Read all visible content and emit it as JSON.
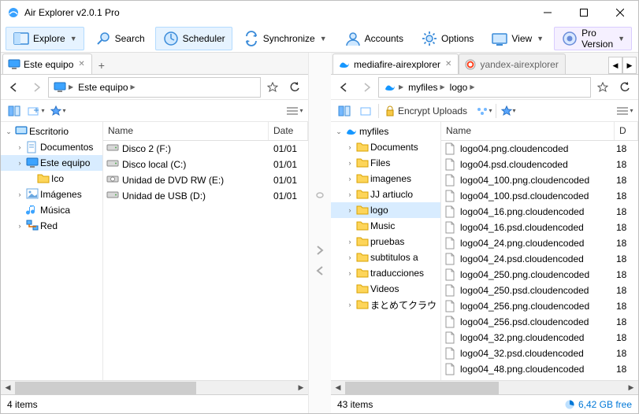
{
  "window": {
    "title": "Air Explorer v2.0.1 Pro"
  },
  "toolbar": [
    {
      "id": "explore",
      "label": "Explore",
      "sel": true,
      "icon": "explore",
      "caret": true
    },
    {
      "id": "search",
      "label": "Search",
      "icon": "search"
    },
    {
      "id": "scheduler",
      "label": "Scheduler",
      "sel": true,
      "icon": "scheduler"
    },
    {
      "id": "sync",
      "label": "Synchronize",
      "icon": "sync",
      "caret": true
    },
    {
      "id": "accounts",
      "label": "Accounts",
      "icon": "accounts"
    },
    {
      "id": "options",
      "label": "Options",
      "icon": "options"
    },
    {
      "id": "view",
      "label": "View",
      "icon": "view",
      "caret": true
    },
    {
      "id": "pro",
      "label": "Pro Version",
      "icon": "pro",
      "caret": true,
      "pro": true
    },
    {
      "id": "help",
      "label": "",
      "icon": "help",
      "caret": true
    }
  ],
  "left": {
    "tabs": [
      {
        "label": "Este equipo",
        "icon": "monitor",
        "active": true
      }
    ],
    "path": [
      {
        "icon": "monitor"
      },
      {
        "label": "Este equipo"
      }
    ],
    "tree": [
      {
        "depth": 0,
        "exp": "v",
        "icon": "desktop",
        "label": "Escritorio"
      },
      {
        "depth": 1,
        "exp": ">",
        "icon": "docs",
        "label": "Documentos",
        "hov": false
      },
      {
        "depth": 1,
        "exp": ">",
        "icon": "monitor",
        "label": "Este equipo",
        "sel": true
      },
      {
        "depth": 2,
        "exp": "",
        "icon": "folder",
        "label": "Ico"
      },
      {
        "depth": 1,
        "exp": ">",
        "icon": "pics",
        "label": "Imágenes"
      },
      {
        "depth": 1,
        "exp": "",
        "icon": "music",
        "label": "Música"
      },
      {
        "depth": 1,
        "exp": ">",
        "icon": "net",
        "label": "Red"
      }
    ],
    "columns": {
      "name": "Name",
      "date": "Date"
    },
    "items": [
      {
        "name": "Disco 2 (F:)",
        "date": "01/01",
        "icon": "drive"
      },
      {
        "name": "Disco local (C:)",
        "date": "01/01",
        "icon": "drive"
      },
      {
        "name": "Unidad de DVD RW (E:)",
        "date": "01/01",
        "icon": "dvd"
      },
      {
        "name": "Unidad de USB (D:)",
        "date": "01/01",
        "icon": "drive"
      }
    ],
    "status": "4 items"
  },
  "right": {
    "tabs": [
      {
        "label": "mediafire-airexplorer",
        "icon": "mediafire",
        "active": true
      },
      {
        "label": "yandex-airexplorer",
        "icon": "yandex",
        "active": false
      }
    ],
    "path": [
      {
        "icon": "mediafire"
      },
      {
        "label": "myfiles"
      },
      {
        "label": "logo"
      }
    ],
    "encrypt_label": "Encrypt Uploads",
    "tree": [
      {
        "depth": 0,
        "exp": "v",
        "icon": "mediafire",
        "label": "myfiles"
      },
      {
        "depth": 1,
        "exp": ">",
        "icon": "folder",
        "label": "Documents"
      },
      {
        "depth": 1,
        "exp": ">",
        "icon": "folder",
        "label": "Files"
      },
      {
        "depth": 1,
        "exp": ">",
        "icon": "folder",
        "label": "imagenes"
      },
      {
        "depth": 1,
        "exp": ">",
        "icon": "folder",
        "label": "JJ artiuclo"
      },
      {
        "depth": 1,
        "exp": ">",
        "icon": "folder",
        "label": "logo",
        "sel": true
      },
      {
        "depth": 1,
        "exp": "",
        "icon": "folder",
        "label": "Music"
      },
      {
        "depth": 1,
        "exp": ">",
        "icon": "folder",
        "label": "pruebas"
      },
      {
        "depth": 1,
        "exp": ">",
        "icon": "folder",
        "label": "subtitulos a"
      },
      {
        "depth": 1,
        "exp": ">",
        "icon": "folder",
        "label": "traducciones"
      },
      {
        "depth": 1,
        "exp": "",
        "icon": "folder",
        "label": "Videos"
      },
      {
        "depth": 1,
        "exp": ">",
        "icon": "folder",
        "label": "まとめてクラウ"
      }
    ],
    "columns": {
      "name": "Name",
      "date": "D"
    },
    "items": [
      {
        "name": "logo04.png.cloudencoded",
        "date": "18",
        "icon": "file"
      },
      {
        "name": "logo04.psd.cloudencoded",
        "date": "18",
        "icon": "file"
      },
      {
        "name": "logo04_100.png.cloudencoded",
        "date": "18",
        "icon": "file"
      },
      {
        "name": "logo04_100.psd.cloudencoded",
        "date": "18",
        "icon": "file"
      },
      {
        "name": "logo04_16.png.cloudencoded",
        "date": "18",
        "icon": "file"
      },
      {
        "name": "logo04_16.psd.cloudencoded",
        "date": "18",
        "icon": "file"
      },
      {
        "name": "logo04_24.png.cloudencoded",
        "date": "18",
        "icon": "file"
      },
      {
        "name": "logo04_24.psd.cloudencoded",
        "date": "18",
        "icon": "file"
      },
      {
        "name": "logo04_250.png.cloudencoded",
        "date": "18",
        "icon": "file"
      },
      {
        "name": "logo04_250.psd.cloudencoded",
        "date": "18",
        "icon": "file"
      },
      {
        "name": "logo04_256.png.cloudencoded",
        "date": "18",
        "icon": "file"
      },
      {
        "name": "logo04_256.psd.cloudencoded",
        "date": "18",
        "icon": "file"
      },
      {
        "name": "logo04_32.png.cloudencoded",
        "date": "18",
        "icon": "file"
      },
      {
        "name": "logo04_32.psd.cloudencoded",
        "date": "18",
        "icon": "file"
      },
      {
        "name": "logo04_48.png.cloudencoded",
        "date": "18",
        "icon": "file"
      }
    ],
    "status": "43 items",
    "free": "6,42 GB free"
  },
  "icons": {
    "folder_color": "#fdd55a",
    "folder_stroke": "#d9a200"
  }
}
